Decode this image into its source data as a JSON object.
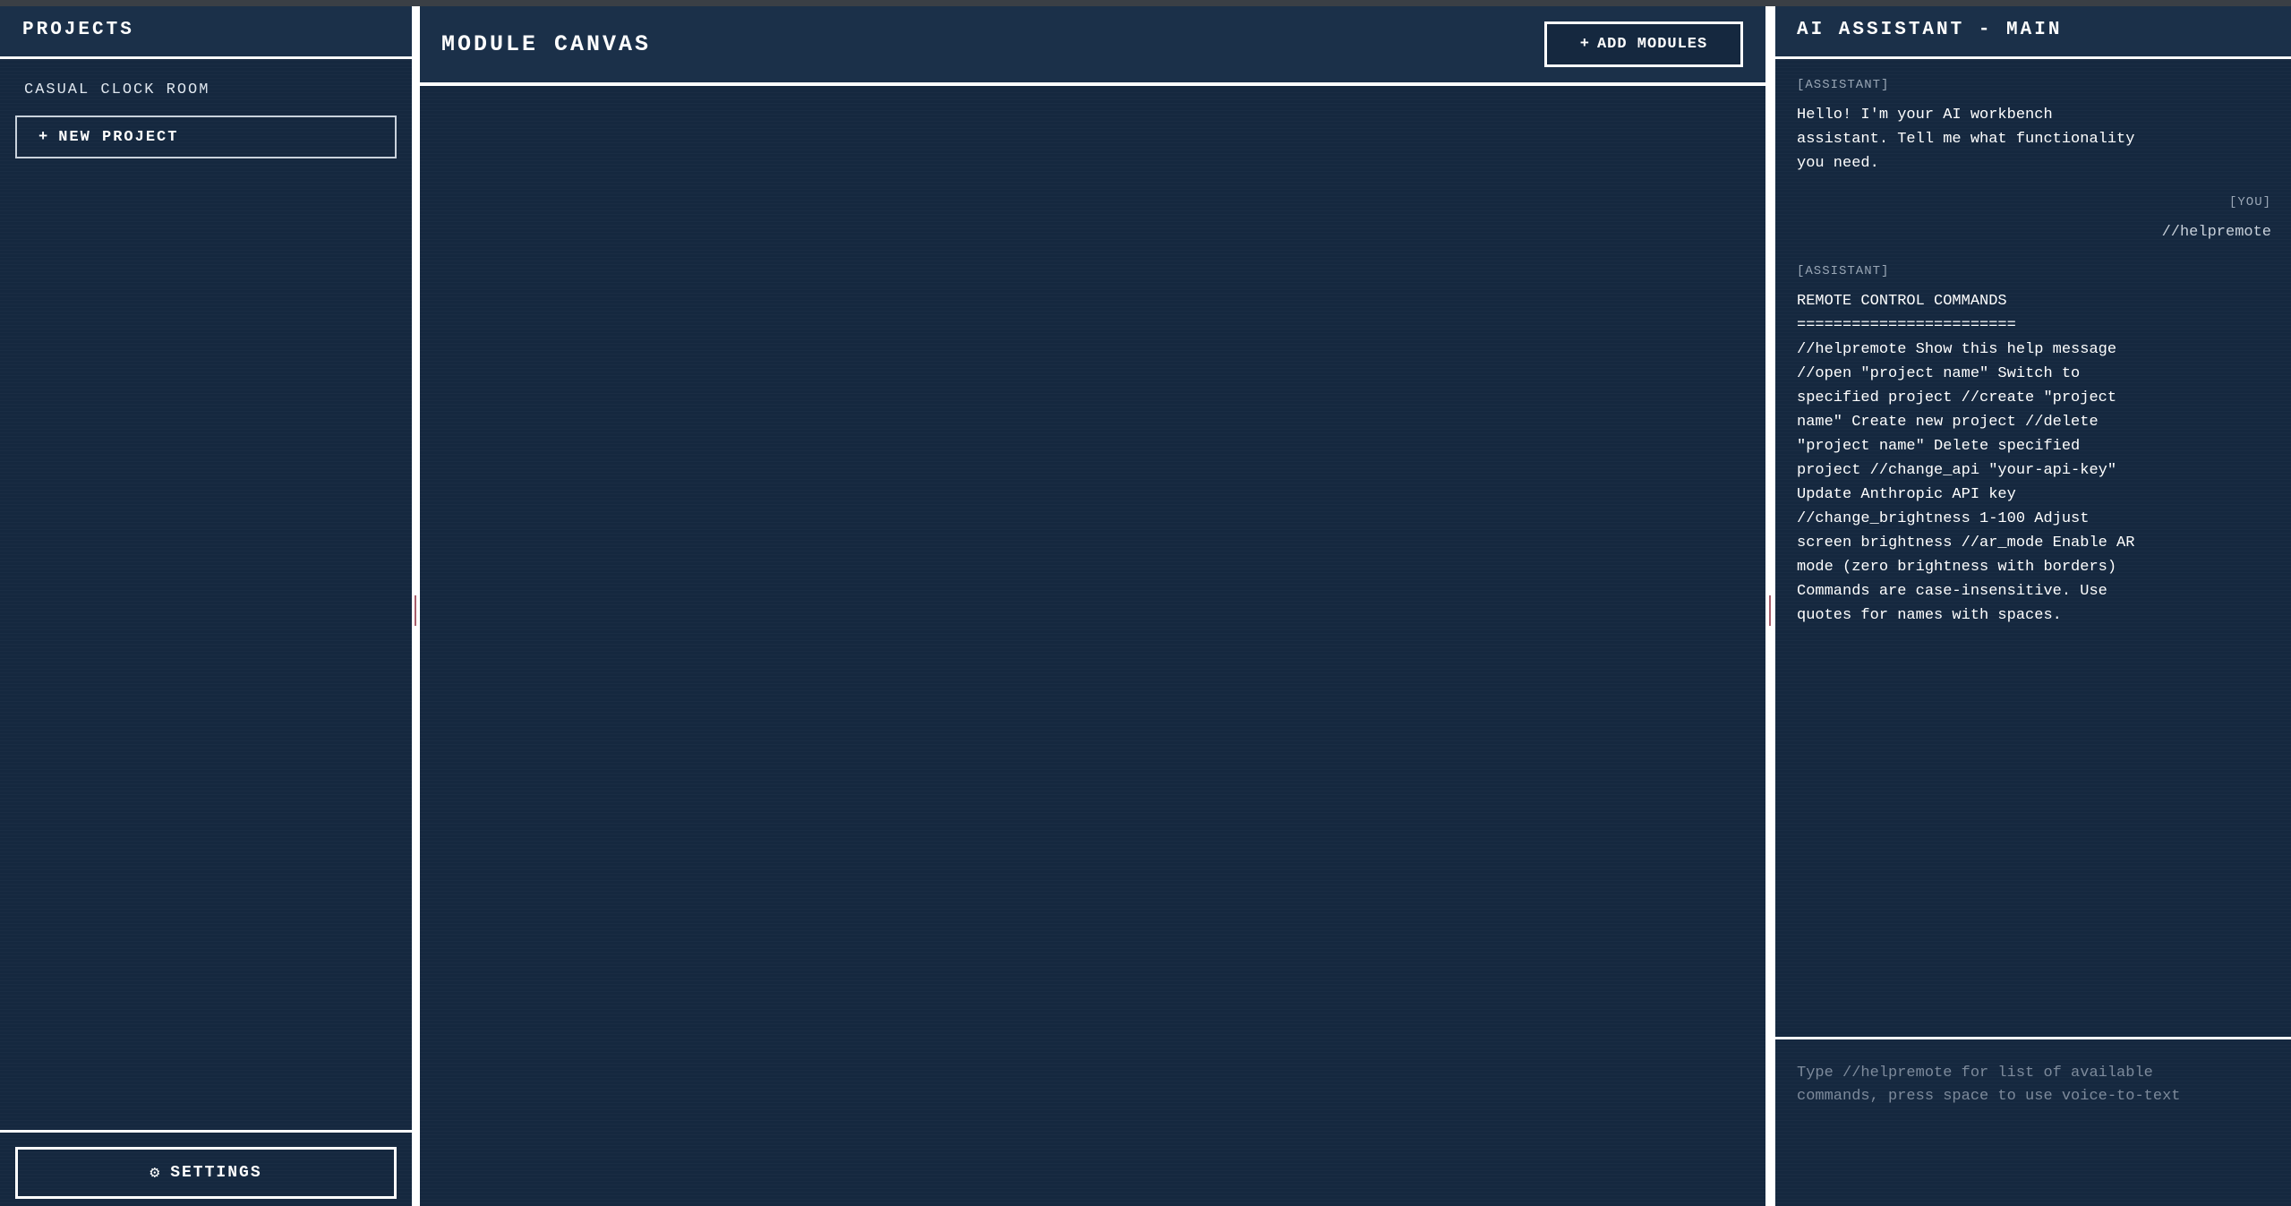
{
  "left_panel": {
    "title": "PROJECTS",
    "projects": [
      {
        "label": "CASUAL CLOCK ROOM"
      }
    ],
    "new_project_icon": "+",
    "new_project_label": "NEW PROJECT",
    "settings_icon": "⚙",
    "settings_label": "SETTINGS"
  },
  "center_panel": {
    "title": "MODULE CANVAS",
    "add_modules_icon": "+",
    "add_modules_label": "ADD MODULES"
  },
  "right_panel": {
    "title": "AI ASSISTANT - MAIN",
    "messages": [
      {
        "role": "[ASSISTANT]",
        "text": "Hello! I'm your AI workbench assistant. Tell me what functionality you need."
      },
      {
        "role": "[YOU]",
        "text": "//helpremote"
      },
      {
        "role": "[ASSISTANT]",
        "heading": "REMOTE CONTROL COMMANDS",
        "rule": "========================",
        "text": "//helpremote Show this help message //open \"project name\" Switch to specified project //create \"project name\" Create new project //delete \"project name\" Delete specified project //change_api \"your-api-key\" Update Anthropic API key //change_brightness 1-100 Adjust screen brightness //ar_mode Enable AR mode (zero brightness with borders) Commands are case-insensitive. Use quotes for names with spaces."
      }
    ],
    "input_placeholder": "Type //helpremote for list of available commands, press space to use voice-to-text",
    "input_value": ""
  },
  "colors": {
    "panel_bg": "#15283f",
    "header_bg": "#1b3049",
    "border": "#ffffff",
    "muted_text": "#9aa7b6",
    "divider_handle": "#a85c6a"
  }
}
